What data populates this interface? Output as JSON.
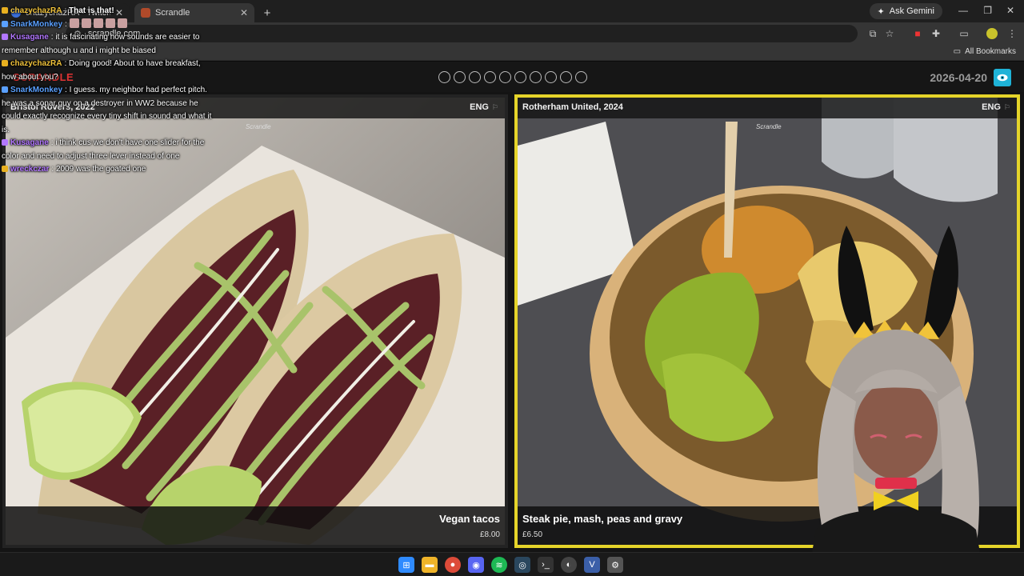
{
  "browser": {
    "tabs": [
      {
        "title": "chazychazRA - Twitch",
        "active": false
      },
      {
        "title": "Scrandle",
        "active": true
      }
    ],
    "ask_gemini": "Ask Gemini",
    "url": "scrandle.com",
    "all_bookmarks": "All Bookmarks"
  },
  "site": {
    "logo": "SCRANDLE",
    "round_dots": 10,
    "date": "2026-04-20"
  },
  "cards": [
    {
      "team": "Bristol Rovers, 2022",
      "lang": "ENG",
      "watermark": "Scrandle",
      "dish": "Vegan tacos",
      "price": "£8.00"
    },
    {
      "team": "Rotherham United, 2024",
      "lang": "ENG",
      "watermark": "Scrandle",
      "dish": "Steak pie, mash, peas and gravy",
      "price": "£6.50"
    }
  ],
  "chat": [
    {
      "user": "chazychazRA",
      "color": "#f0c23b",
      "text": "That is that!"
    },
    {
      "user": "SnarkMonkey",
      "color": "#5aa0ff",
      "text": ""
    },
    {
      "user": "Kusagane",
      "color": "#b277ff",
      "text": "it is fascinating how sounds are easier to remember although u and i might be biased"
    },
    {
      "user": "chazychazRA",
      "color": "#f0c23b",
      "text": "Doing good! About to have breakfast, how about you?"
    },
    {
      "user": "SnarkMonkey",
      "color": "#5aa0ff",
      "text": "I guess. my neighbor had perfect pitch. he was a sonar guy on a destroyer in WW2 because he could exactly recognize every tiny shift in sound and what it is."
    },
    {
      "user": "Kusagane",
      "color": "#b277ff",
      "text": "i think cus we don't have one slider for the color and need to adjust three lever instead of one"
    },
    {
      "user": "wreckczar",
      "color": "#b277ff",
      "text": "2009 was the goated one"
    }
  ],
  "taskbar": {
    "apps": [
      "start-icon",
      "file-explorer-icon",
      "chrome-icon",
      "discord-icon",
      "spotify-icon",
      "steam-icon",
      "terminal-icon",
      "obs-icon",
      "vtube-studio-icon",
      "settings-icon"
    ]
  },
  "colors": {
    "selected_border": "#e5d42a",
    "eye_button": "#1fb3d8",
    "logo": "#dd3333"
  }
}
